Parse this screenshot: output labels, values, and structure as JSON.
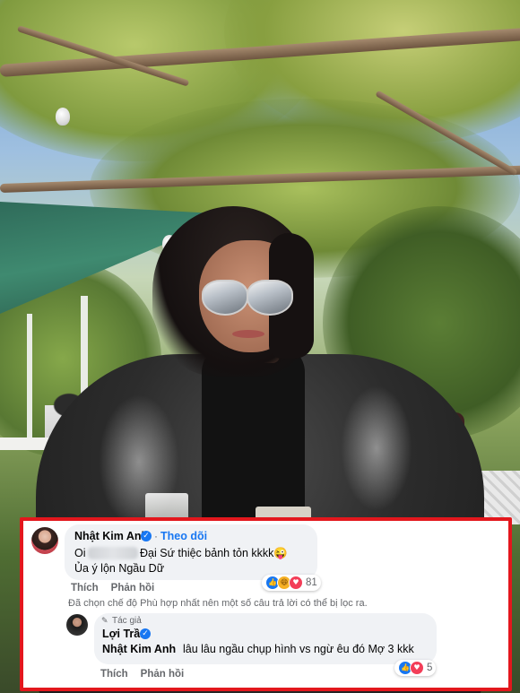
{
  "comment_1": {
    "author": "Nhật Kim Anh",
    "follow_label": "Theo dõi",
    "text_prefix": "Oi",
    "text_suffix": "Đại Sứ thiệc bảnh tỏn kkkk😜",
    "text_line_2": "Ủa ý lộn Ngầu Dữ",
    "reaction_count": "81",
    "like_label": "Thích",
    "reply_label": "Phản hồi"
  },
  "filter_notice": "Đã chọn chế độ Phù hợp nhất nên một số câu trả lời có thể bị lọc ra.",
  "comment_2": {
    "author_tag": "Tác giả",
    "author": "Lợi Trần",
    "mention": "Nhật Kim Anh",
    "text": "lâu lâu ngầu chụp hình vs ngừ êu đó Mợ 3 kkk",
    "reaction_count": "5",
    "like_label": "Thích",
    "reply_label": "Phản hồi"
  },
  "icons": {
    "verified": "verified-badge-icon",
    "like": "like-reaction-icon",
    "haha": "haha-reaction-icon",
    "love": "love-reaction-icon",
    "author_tag": "pen-icon"
  },
  "colors": {
    "highlight_border": "#e3171d",
    "link_blue": "#1877f2",
    "bubble_bg": "#f0f2f5",
    "meta_gray": "#65676b"
  }
}
